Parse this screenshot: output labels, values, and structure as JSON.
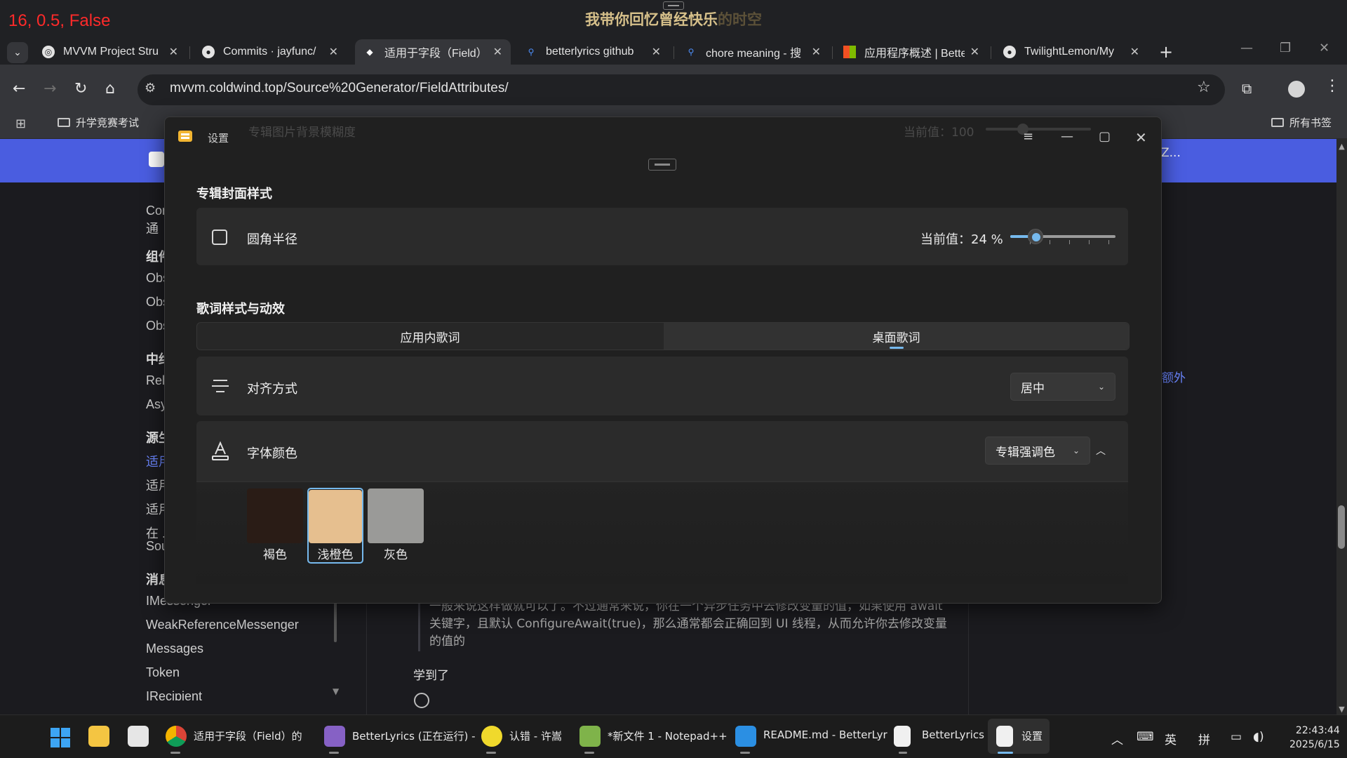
{
  "overlay": {
    "debug_text": "16, 0.5, False",
    "desktop_lyric_bright": "我带你回忆曾经快乐",
    "desktop_lyric_dim": "的时空"
  },
  "browser": {
    "tabs": [
      {
        "label": "MVVM Project Stru",
        "icon": "generic-globe-icon"
      },
      {
        "label": "Commits · jayfunc/",
        "icon": "github-icon"
      },
      {
        "label": "适用于字段（Field）",
        "icon": "mvvm-site-icon",
        "active": true
      },
      {
        "label": "betterlyrics github",
        "icon": "search-icon"
      },
      {
        "label": "chore meaning - 搜",
        "icon": "search-icon"
      },
      {
        "label": "应用程序概述 | Bette",
        "icon": "microsoft-icon"
      },
      {
        "label": "TwilightLemon/My",
        "icon": "github-icon"
      }
    ],
    "url": "mvvm.coldwind.top/Source%20Generator/FieldAttributes/",
    "bookmarks": [
      {
        "label": "升学竞赛考试"
      },
      {
        "label": "所有书签"
      }
    ]
  },
  "webpage": {
    "header_right_text": "Z...",
    "sidebar": [
      {
        "label": "Cor",
        "type": "item"
      },
      {
        "label": "通",
        "type": "item"
      },
      {
        "label": "组件",
        "type": "section"
      },
      {
        "label": "Obs",
        "type": "item"
      },
      {
        "label": "Obs",
        "type": "item"
      },
      {
        "label": "Obs",
        "type": "item"
      },
      {
        "label": "中约",
        "type": "section"
      },
      {
        "label": "Rel",
        "type": "item"
      },
      {
        "label": "Asy",
        "type": "item"
      },
      {
        "label": "源生",
        "type": "section"
      },
      {
        "label": "适用",
        "type": "active"
      },
      {
        "label": "适用",
        "type": "item"
      },
      {
        "label": "适用",
        "type": "item"
      },
      {
        "label": "在 .",
        "type": "item"
      },
      {
        "label": "Sou",
        "type": "item"
      },
      {
        "label": "消息",
        "type": "section"
      },
      {
        "label": "IMessenger",
        "type": "item"
      },
      {
        "label": "WeakReferenceMessenger",
        "type": "item"
      },
      {
        "label": "Messages",
        "type": "item"
      },
      {
        "label": "Token",
        "type": "item"
      },
      {
        "label": "IRecipient",
        "type": "item"
      }
    ],
    "quote": "一般来说这样做就可以了。不过通常来说，你在一个异步任务中去修改变量的值，如果使用 await 关键字，且默认 ConfigureAwait(true)，那么通常都会正确回到 UI 线程，从而允许你去修改变量的值的",
    "reply": "学到了",
    "right_link": "额外"
  },
  "settings": {
    "title": "设置",
    "ghost_label": "专辑图片背景模糊度",
    "ghost_value": "当前值：100",
    "album_section": "专辑封面样式",
    "corner_radius_label": "圆角半径",
    "corner_radius_value_text": "当前值：24 %",
    "corner_radius_percent": 24,
    "lyrics_section": "歌词样式与动效",
    "segments": [
      "应用内歌词",
      "桌面歌词"
    ],
    "selected_segment": "桌面歌词",
    "alignment_label": "对齐方式",
    "alignment_value": "居中",
    "font_color_label": "字体颜色",
    "font_color_value": "专辑强调色",
    "swatches": [
      {
        "label": "褐色",
        "color": "#2a1c16"
      },
      {
        "label": "浅橙色",
        "color": "#e6bf8f",
        "selected": true
      },
      {
        "label": "灰色",
        "color": "#9a9a98"
      }
    ],
    "accent_color": "#76b9ed"
  },
  "taskbar": {
    "apps": [
      {
        "label": "适用于字段（Field）的",
        "icon": "chrome-icon"
      },
      {
        "label": "BetterLyrics (正在运行) -",
        "icon": "visual-studio-icon"
      },
      {
        "label": "认错 - 许嵩",
        "icon": "music-player-icon"
      },
      {
        "label": "*新文件 1 - Notepad++",
        "icon": "notepad-plus-icon"
      },
      {
        "label": "README.md - BetterLyr",
        "icon": "vscode-icon"
      },
      {
        "label": "BetterLyrics",
        "icon": "document-icon"
      },
      {
        "label": "设置",
        "icon": "document-icon"
      }
    ],
    "ime_lang": "英",
    "ime_mode": "拼",
    "time": "22:43:44",
    "date": "2025/6/15"
  }
}
